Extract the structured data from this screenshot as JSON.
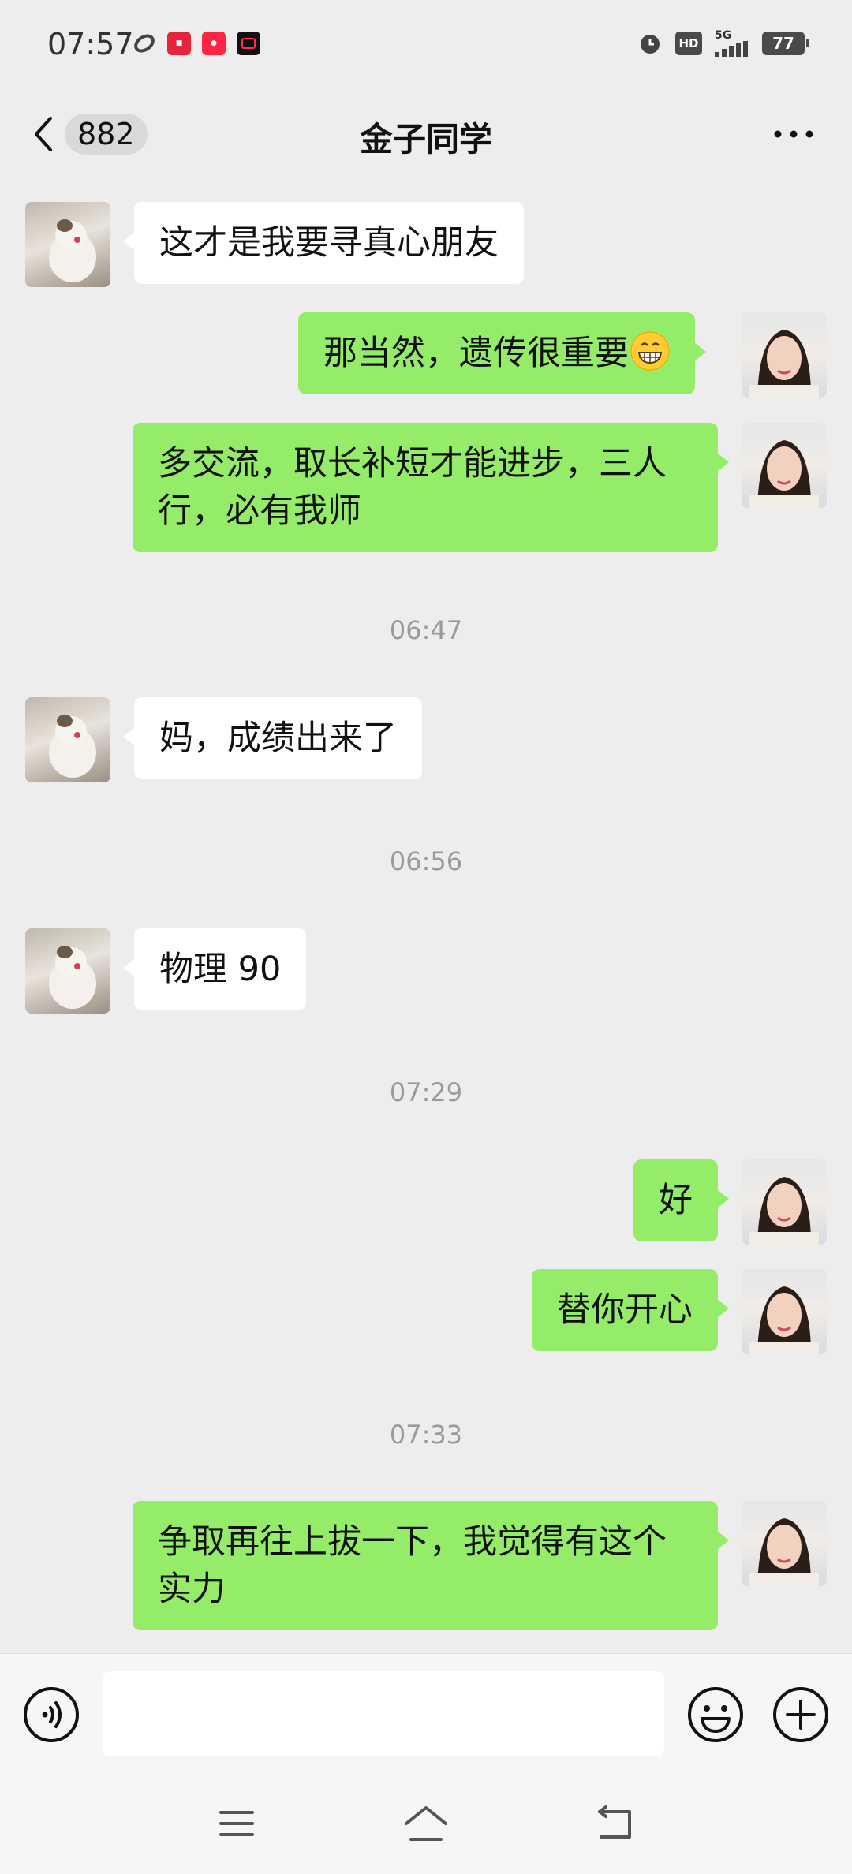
{
  "status_bar": {
    "time": "07:57",
    "app_icons": [
      "app-icon-1",
      "app-icon-2",
      "app-icon-3",
      "app-icon-4"
    ],
    "hd": "HD",
    "network": "5G",
    "battery": "77"
  },
  "header": {
    "unread_count": "882",
    "title": "金子同学"
  },
  "messages": [
    {
      "side": "left",
      "text": "这才是我要寻真心朋友"
    },
    {
      "side": "right",
      "text": "那当然，遗传很重要"
    },
    {
      "side": "right",
      "text": "多交流，取长补短才能进步，三人行，必有我师"
    },
    {
      "side": "timestamp",
      "text": "06:47"
    },
    {
      "side": "left",
      "text": "妈，成绩出来了"
    },
    {
      "side": "timestamp",
      "text": "06:56"
    },
    {
      "side": "left",
      "text": "物理 90"
    },
    {
      "side": "timestamp",
      "text": "07:29"
    },
    {
      "side": "right",
      "text": "好"
    },
    {
      "side": "right",
      "text": "替你开心"
    },
    {
      "side": "timestamp",
      "text": "07:33"
    },
    {
      "side": "right",
      "text": "争取再往上拔一下，我觉得有这个实力"
    }
  ],
  "input": {
    "placeholder": ""
  },
  "colors": {
    "background": "#ededed",
    "sent_bubble": "#95ec69",
    "received_bubble": "#ffffff"
  }
}
